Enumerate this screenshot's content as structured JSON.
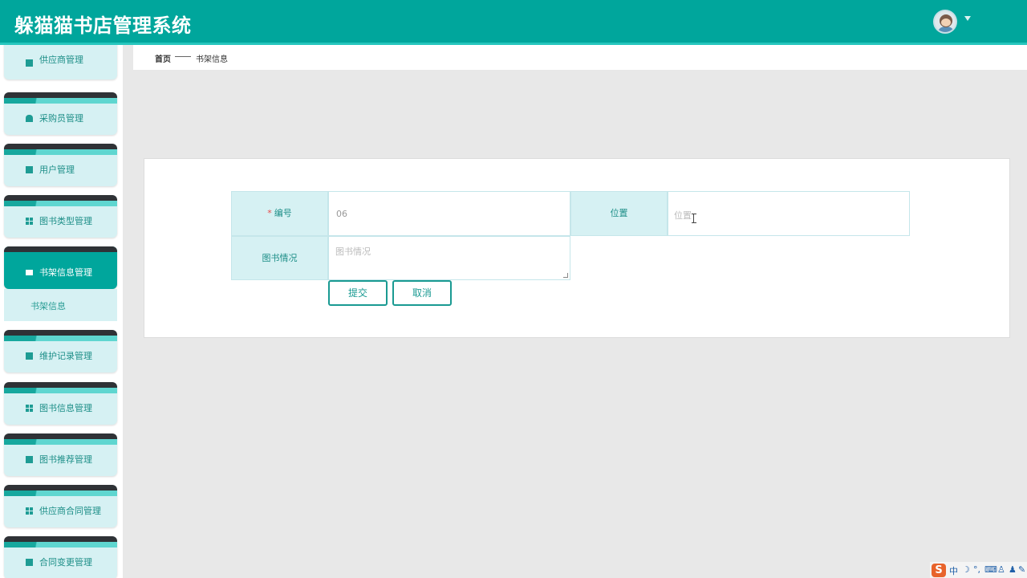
{
  "header": {
    "title": "躲猫猫书店管理系统"
  },
  "sidebar": {
    "items": [
      {
        "label": "供应商管理",
        "icon": "message-icon"
      },
      {
        "label": "采购员管理",
        "icon": "user-icon"
      },
      {
        "label": "用户管理",
        "icon": "clipboard-icon"
      },
      {
        "label": "图书类型管理",
        "icon": "grid-icon"
      },
      {
        "label": "书架信息管理",
        "icon": "ticket-icon"
      },
      {
        "label": "维护记录管理",
        "icon": "chart-icon"
      },
      {
        "label": "图书信息管理",
        "icon": "grid-icon"
      },
      {
        "label": "图书推荐管理",
        "icon": "clipboard-check-icon"
      },
      {
        "label": "供应商合同管理",
        "icon": "grid-icon"
      },
      {
        "label": "合同变更管理",
        "icon": "wallet-icon"
      }
    ],
    "submenu": {
      "label": "书架信息"
    }
  },
  "breadcrumb": {
    "home": "首页",
    "current": "书架信息"
  },
  "form": {
    "number_label": "编号",
    "number_required_mark": "*",
    "number_value": "06",
    "location_label": "位置",
    "location_placeholder": "位置",
    "book_status_label": "图书情况",
    "book_status_placeholder": "图书情况",
    "submit_label": "提交",
    "cancel_label": "取消"
  },
  "tray": {
    "ime": "中"
  },
  "colors": {
    "brand": "#00a69c",
    "light": "#d6f1f3",
    "dark_tab": "#2f3236"
  }
}
